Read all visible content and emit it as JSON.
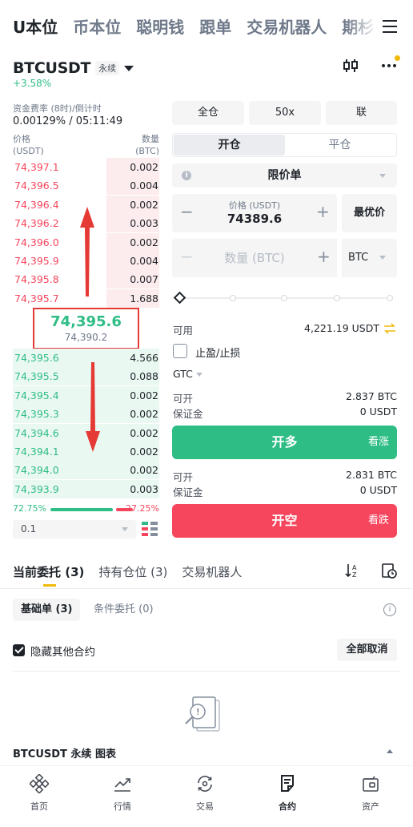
{
  "nav": {
    "tabs": [
      "U本位",
      "币本位",
      "聪明钱",
      "跟单",
      "交易机器人",
      "期杉"
    ]
  },
  "symbol": {
    "name": "BTCUSDT",
    "type": "永续",
    "change": "+3.58%"
  },
  "funding": {
    "label": "资金费率 (8时)/倒计时",
    "value": "0.00129% / 05:11:49"
  },
  "orderbook": {
    "price_label": "价格",
    "price_unit": "(USDT)",
    "qty_label": "数量",
    "qty_unit": "(BTC)",
    "asks": [
      {
        "price": "74,397.1",
        "qty": "0.002",
        "depth": 0.36
      },
      {
        "price": "74,396.5",
        "qty": "0.004",
        "depth": 0.36
      },
      {
        "price": "74,396.4",
        "qty": "0.002",
        "depth": 0.36
      },
      {
        "price": "74,396.2",
        "qty": "0.003",
        "depth": 0.36
      },
      {
        "price": "74,396.0",
        "qty": "0.002",
        "depth": 0.36
      },
      {
        "price": "74,395.9",
        "qty": "0.004",
        "depth": 0.36
      },
      {
        "price": "74,395.8",
        "qty": "0.007",
        "depth": 0.36
      },
      {
        "price": "74,395.7",
        "qty": "1.688",
        "depth": 0.36
      }
    ],
    "last_price": "74,395.6",
    "mark_price": "74,390.2",
    "bids": [
      {
        "price": "74,395.6",
        "qty": "4.566",
        "depth": 1.0
      },
      {
        "price": "74,395.5",
        "qty": "0.088",
        "depth": 1.0
      },
      {
        "price": "74,395.4",
        "qty": "0.002",
        "depth": 1.0
      },
      {
        "price": "74,395.3",
        "qty": "0.002",
        "depth": 1.0
      },
      {
        "price": "74,394.6",
        "qty": "0.002",
        "depth": 1.0
      },
      {
        "price": "74,394.1",
        "qty": "0.002",
        "depth": 1.0
      },
      {
        "price": "74,394.0",
        "qty": "0.002",
        "depth": 1.0
      },
      {
        "price": "74,393.9",
        "qty": "0.003",
        "depth": 1.0
      }
    ],
    "buy_ratio": "72.75%",
    "sell_ratio": "27.25%",
    "precision": "0.1"
  },
  "trade": {
    "margin_mode": "全仓",
    "leverage": "50x",
    "position_mode": "联",
    "open_tab": "开仓",
    "close_tab": "平仓",
    "order_type": "限价单",
    "price_caption": "价格 (USDT)",
    "price_value": "74389.6",
    "best_price": "最优价",
    "qty_placeholder": "数量 (BTC)",
    "qty_unit": "BTC",
    "available_label": "可用",
    "available_value": "4,221.19 USDT",
    "tpsl_label": "止盈/止损",
    "tif": "GTC",
    "long_open_label": "可开",
    "long_open_value": "2.837 BTC",
    "long_margin_label": "保证金",
    "long_margin_value": "0 USDT",
    "buy_button": "开多",
    "buy_sub": "看涨",
    "short_open_label": "可开",
    "short_open_value": "2.831 BTC",
    "short_margin_label": "保证金",
    "short_margin_value": "0 USDT",
    "sell_button": "开空",
    "sell_sub": "看跌"
  },
  "orders": {
    "tabs": [
      "当前委托 (3)",
      "持有仓位 (3)",
      "交易机器人"
    ],
    "sub_basic": "基础单 (3)",
    "sub_conditional": "条件委托 (0)",
    "hide_others": "隐藏其他合约",
    "cancel_all": "全部取消"
  },
  "chart_bar": {
    "label": "BTCUSDT 永续 图表"
  },
  "bottom_nav": {
    "items": [
      "首页",
      "行情",
      "交易",
      "合约",
      "资产"
    ]
  },
  "colors": {
    "green": "#2ebd85",
    "red": "#f6465d",
    "yellow": "#f0b90b",
    "annotation": "#e53935"
  }
}
